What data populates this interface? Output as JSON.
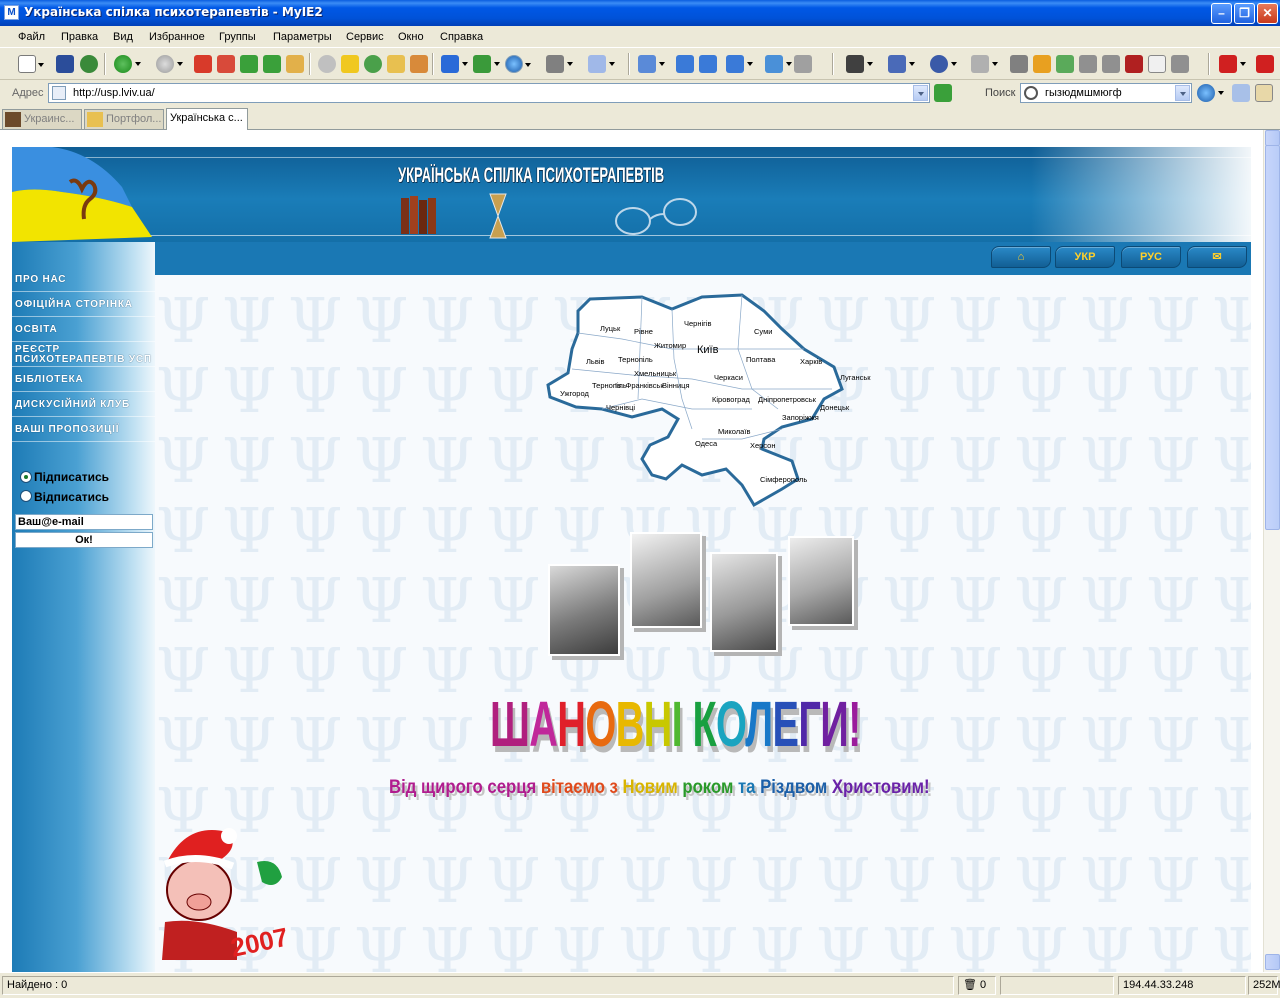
{
  "window": {
    "title": "Українська спілка психотерапевтів - MyIE2",
    "app_icon": "M"
  },
  "menu": [
    "Файл",
    "Правка",
    "Вид",
    "Избранное",
    "Группы",
    "Параметры",
    "Сервис",
    "Окно",
    "Справка"
  ],
  "address": {
    "label": "Адрес",
    "url": "http://usp.lviv.ua/"
  },
  "search": {
    "label": "Поиск",
    "value": "гызюдмшмюгф"
  },
  "tabs": [
    {
      "label": "Украинс..."
    },
    {
      "label": "Портфол..."
    },
    {
      "label": "Українська с..."
    }
  ],
  "site": {
    "title": "УКРАЇНСЬКА СПІЛКА ПСИХОТЕРАПЕВТІВ",
    "nav": [
      {
        "label": "",
        "icon": "home-icon"
      },
      {
        "label": "УКР"
      },
      {
        "label": "РУС"
      },
      {
        "label": "",
        "icon": "mail-icon"
      }
    ],
    "sidebar": [
      "ПРО НАС",
      "ОФІЦІЙНА СТОРІНКА",
      "ОСВІТА",
      "РЕЄСТР",
      "ПСИХОТЕРАПЕВТІВ УСП",
      "БІБЛІОТЕКА",
      "ДИСКУСІЙНИЙ КЛУБ",
      "ВАШІ ПРОПОЗИЦІЇ"
    ],
    "subscribe": {
      "opt1": "Підписатись",
      "opt2": "Відписатись",
      "email": "Ваш@e-mail",
      "ok": "Ок!"
    },
    "map_cities": [
      "Луцьк",
      "Рівне",
      "Житомир",
      "Чернігів",
      "Суми",
      "Київ",
      "Полтава",
      "Харків",
      "Львів",
      "Тернопіль",
      "Хмельницьк",
      "Вінниця",
      "Черкаси",
      "Луганськ",
      "Тернопіль",
      "Ів.-Франківськ",
      "Ужгород",
      "Чернівці",
      "Кіровоград",
      "Дніпропетровськ",
      "Донецьк",
      "Запоріжжя",
      "Миколаїв",
      "Одеса",
      "Херсон",
      "Сімферополь"
    ],
    "greeting_title": [
      "Ш",
      "А",
      "Н",
      "О",
      "В",
      "Н",
      "І",
      " ",
      "К",
      "О",
      "Л",
      "Е",
      "Г",
      "И",
      "!"
    ],
    "greeting_sub": [
      {
        "t": "Від щирого серця ",
        "c": "#b01c8e"
      },
      {
        "t": "вітаємо з ",
        "c": "#e04a1c"
      },
      {
        "t": "Новим ",
        "c": "#d8b400"
      },
      {
        "t": "роком ",
        "c": "#2a9a2a"
      },
      {
        "t": "та ",
        "c": "#1a78b4"
      },
      {
        "t": "Різдвом ",
        "c": "#1c5fa8"
      },
      {
        "t": "Христовим!",
        "c": "#6a22a8"
      }
    ],
    "year_badge": "2007"
  },
  "status": {
    "text": "Найдено : 0",
    "blocked": "0",
    "ip": "194.44.33.248",
    "mem": "252M"
  },
  "colors": {
    "title_bar": "#0058e6",
    "header_blue": "#1a7db8",
    "nav_text": "#ffd02a"
  }
}
